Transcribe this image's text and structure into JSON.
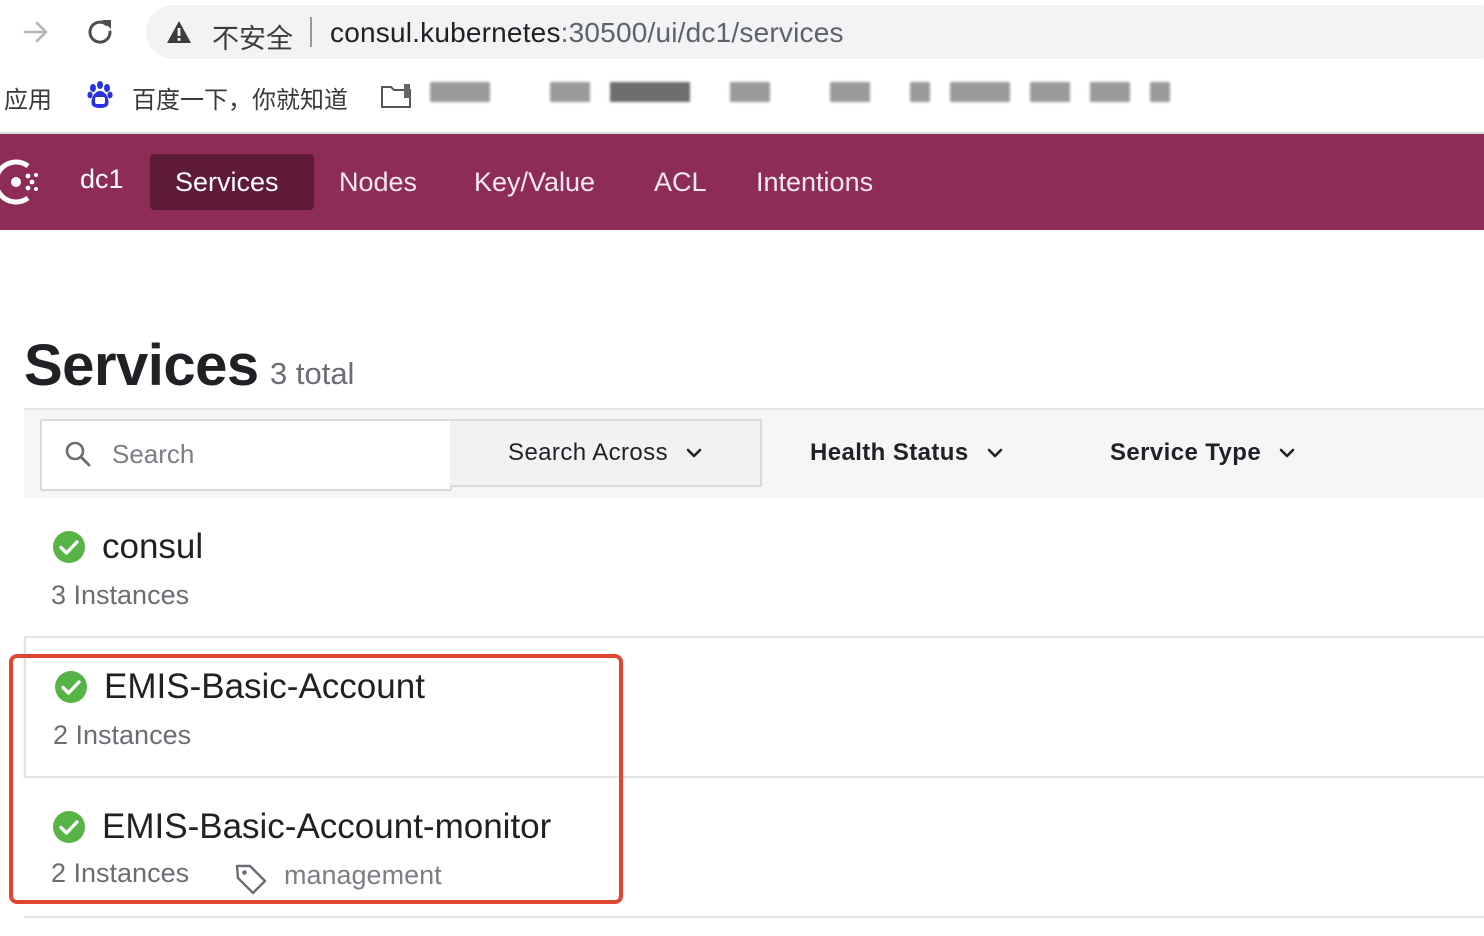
{
  "browser": {
    "insecure_label": "不安全",
    "url_host": "consul.kubernetes",
    "url_path": ":30500/ui/dc1/services"
  },
  "bookmarks": {
    "apps": "应用",
    "baidu": "百度一下，你就知道"
  },
  "header": {
    "datacenter": "dc1",
    "nav": [
      "Services",
      "Nodes",
      "Key/Value",
      "ACL",
      "Intentions"
    ],
    "active_nav": "Services",
    "brand_color": "#8e2c58"
  },
  "page": {
    "title": "Services",
    "total": "3 total"
  },
  "filters": {
    "search_placeholder": "Search",
    "search_value": "",
    "search_across": "Search Across",
    "health_status": "Health Status",
    "service_type": "Service Type"
  },
  "services": [
    {
      "name": "consul",
      "instances": "3 Instances",
      "health": "passing",
      "tag": ""
    },
    {
      "name": "EMIS-Basic-Account",
      "instances": "2 Instances",
      "health": "passing",
      "tag": ""
    },
    {
      "name": "EMIS-Basic-Account-monitor",
      "instances": "2 Instances",
      "health": "passing",
      "tag": "management"
    }
  ],
  "colors": {
    "health_passing": "#57b346",
    "highlight": "#e0452f"
  }
}
